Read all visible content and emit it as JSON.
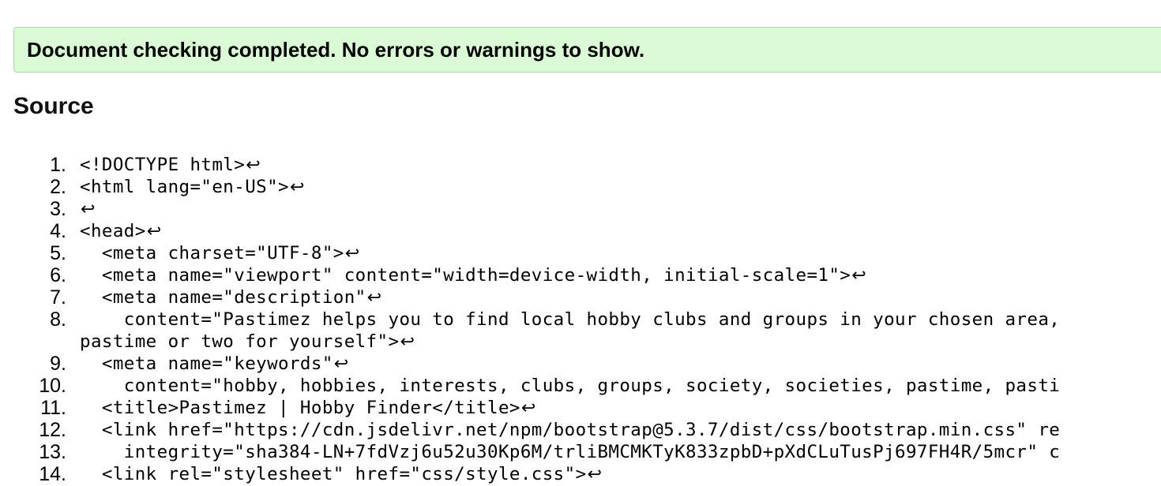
{
  "result": {
    "message": "Document checking completed. No errors or warnings to show."
  },
  "source": {
    "heading": "Source",
    "eol_glyph": "↩",
    "lines": [
      {
        "num": "1.",
        "text": "<!DOCTYPE html>"
      },
      {
        "num": "2.",
        "text": "<html lang=\"en-US\">"
      },
      {
        "num": "3.",
        "text": ""
      },
      {
        "num": "4.",
        "text": "<head>"
      },
      {
        "num": "5.",
        "text": "  <meta charset=\"UTF-8\">"
      },
      {
        "num": "6.",
        "text": "  <meta name=\"viewport\" content=\"width=device-width, initial-scale=1\">"
      },
      {
        "num": "7.",
        "text": "  <meta name=\"description\""
      },
      {
        "num": "8.",
        "text": "    content=\"Pastimez helps you to find local hobby clubs and groups in your chosen area,",
        "text2": "pastime or two for yourself\">"
      },
      {
        "num": "9.",
        "text": "  <meta name=\"keywords\""
      },
      {
        "num": "10.",
        "text": "    content=\"hobby, hobbies, interests, clubs, groups, society, societies, pastime, pasti"
      },
      {
        "num": "11.",
        "text": "  <title>Pastimez | Hobby Finder</title>"
      },
      {
        "num": "12.",
        "text": "  <link href=\"https://cdn.jsdelivr.net/npm/bootstrap@5.3.7/dist/css/bootstrap.min.css\" re"
      },
      {
        "num": "13.",
        "text": "    integrity=\"sha384-LN+7fdVzj6u52u30Kp6M/trliBMCMKTyK833zpbD+pXdCLuTusPj697FH4R/5mcr\" c"
      },
      {
        "num": "14.",
        "text": "  <link rel=\"stylesheet\" href=\"css/style.css\">"
      }
    ],
    "eol_lines": [
      "1.",
      "2.",
      "3.",
      "4.",
      "5.",
      "6.",
      "7.",
      "8.",
      "9.",
      "11.",
      "14."
    ]
  }
}
